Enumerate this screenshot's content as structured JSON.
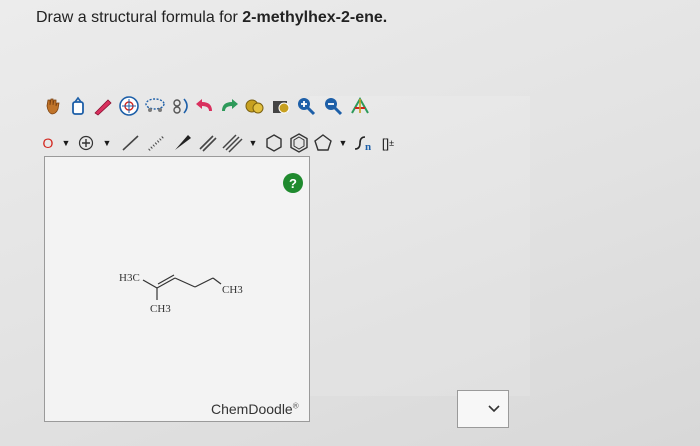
{
  "question": {
    "prefix": "Draw a structural formula for ",
    "compound": "2-methylhex-2-ene."
  },
  "editor": {
    "help_label": "?",
    "brand": "ChemDoodle",
    "brand_mark": "®",
    "toolbar_row2": {
      "atom_label": "O",
      "polymer_label": "n",
      "bracket_label": "[]",
      "bracket_charge": "±"
    },
    "molecule": {
      "label_h3c": "H3C",
      "label_ch3_bottom": "CH3",
      "label_ch3_right": "CH3"
    }
  },
  "colors": {
    "help_green": "#1f8a2e",
    "atom_red": "#d3261e",
    "toolbar_blue": "#1d5fa8"
  }
}
